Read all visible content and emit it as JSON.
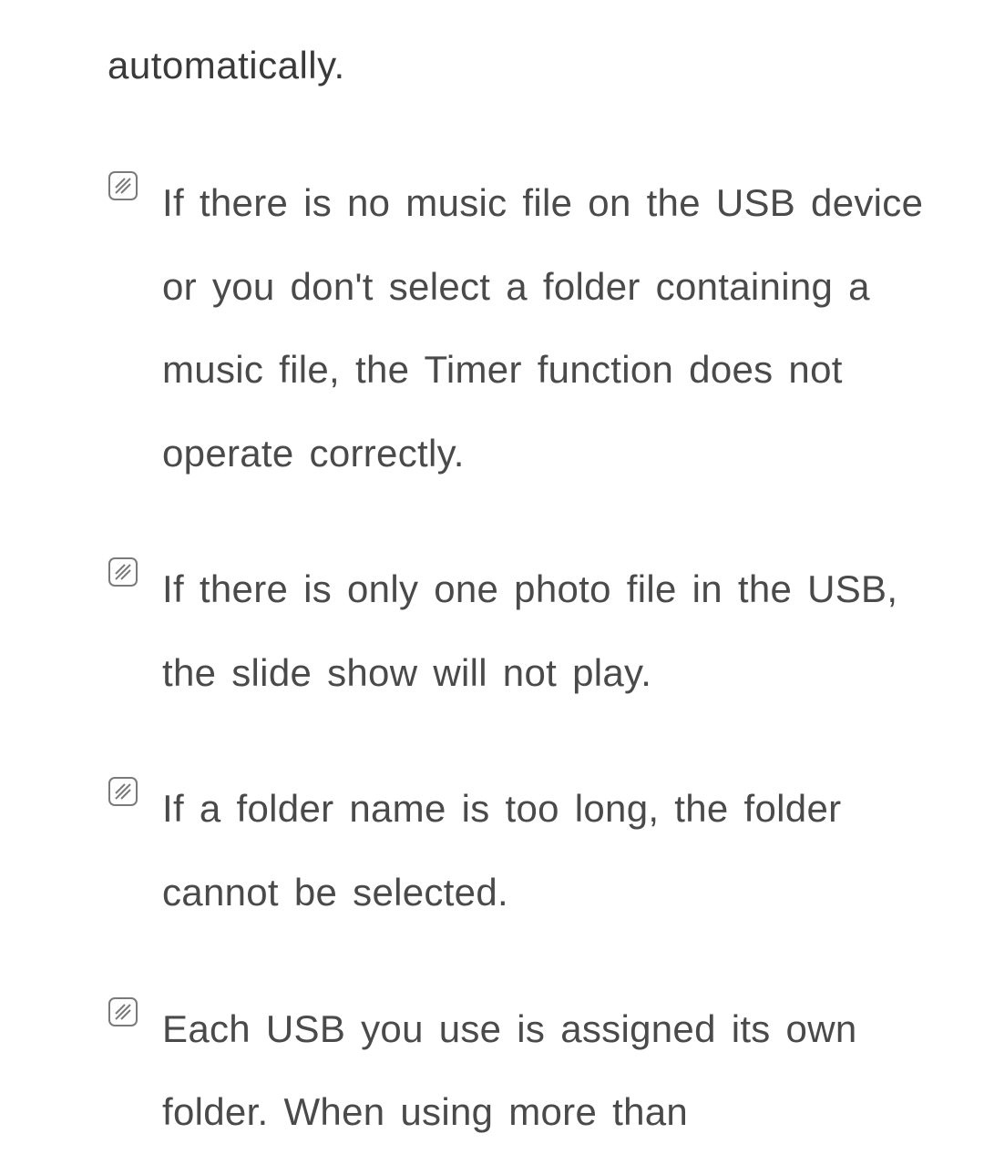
{
  "intro_fragment": "automatically.",
  "notes": [
    {
      "text": "If there is no music file on the USB device or you don't select a folder containing a music file, the Timer function does not operate correctly."
    },
    {
      "text": "If there is only one photo file in the USB, the slide show will not play."
    },
    {
      "text": "If a folder name is too long, the folder cannot be selected."
    },
    {
      "text": "Each USB you use is assigned its own folder. When using more than"
    }
  ],
  "icon_name": "note-icon"
}
